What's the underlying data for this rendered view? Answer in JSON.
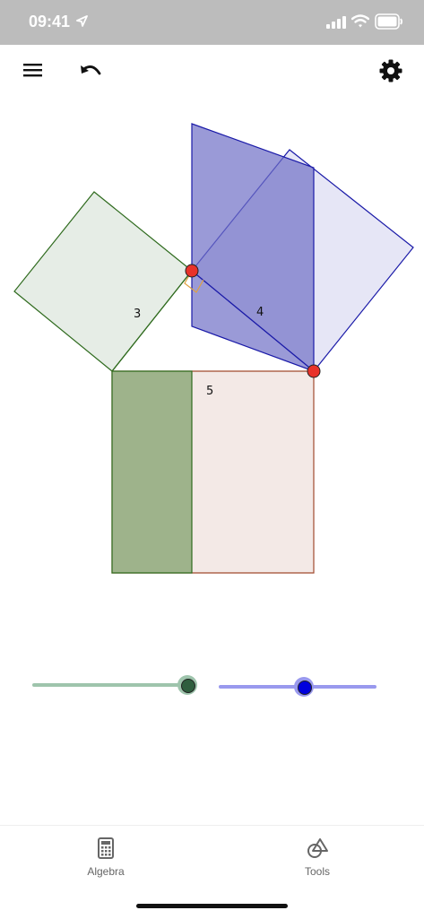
{
  "status_bar": {
    "time": "09:41",
    "icons": [
      "location-arrow-icon",
      "cellular-signal-icon",
      "wifi-icon",
      "battery-icon"
    ]
  },
  "toolbar": {
    "icons": [
      "menu-icon",
      "undo-icon",
      "settings-gear-icon"
    ]
  },
  "construction": {
    "side_labels": {
      "leg_a": "3",
      "leg_b": "4",
      "hypotenuse": "5"
    },
    "colors": {
      "green_square_fill": "#e6ede6",
      "green_stroke": "#2f6b1e",
      "blue_fill_dark": "#7f7fcc",
      "blue_fill_light": "#e6e6f6",
      "blue_stroke": "#1a1aa8",
      "hypotenuse_square_fill": "#f3e9e6",
      "hypotenuse_stroke": "#a04a2e",
      "green_region_fill": "#9eb38b",
      "point_fill": "#e8322a",
      "right_angle_marker": "#e0a040"
    }
  },
  "sliders": [
    {
      "name": "green-slider",
      "color": "#9ec4ac",
      "knob_color": "#2f5e3e",
      "value": 1.0
    },
    {
      "name": "blue-slider",
      "color": "#9999ee",
      "knob_color": "#0000dd",
      "value": 0.54
    }
  ],
  "bottom_nav": {
    "items": [
      {
        "label": "Algebra",
        "icon": "calculator-icon"
      },
      {
        "label": "Tools",
        "icon": "tools-shapes-icon"
      }
    ]
  }
}
